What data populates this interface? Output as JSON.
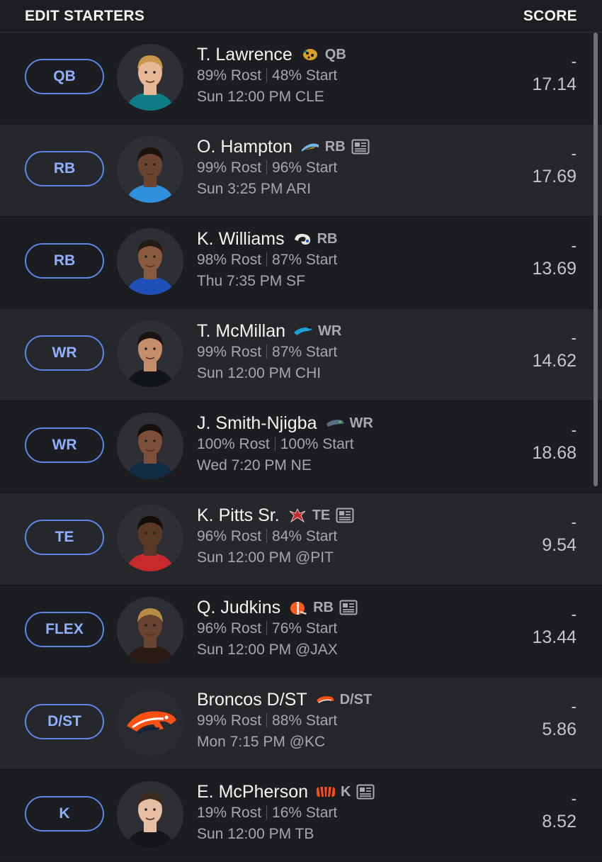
{
  "header": {
    "title": "EDIT STARTERS",
    "score_label": "SCORE"
  },
  "colors": {
    "slot_border": "#5d86e8",
    "slot_text": "#8fb0ff"
  },
  "rows": [
    {
      "slot": "QB",
      "name": "T. Lawrence",
      "team_logo": "jaguars-logo-icon",
      "pos": "QB",
      "news": false,
      "rost": "89% Rost",
      "start": "48% Start",
      "game": "Sun 12:00 PM CLE",
      "score_dash": "-",
      "score": "17.14",
      "avatar": {
        "skin": "#e8b896",
        "hair": "#c8964a",
        "jersey": "#0f7d86"
      }
    },
    {
      "slot": "RB",
      "name": "O. Hampton",
      "team_logo": "chargers-logo-icon",
      "pos": "RB",
      "news": true,
      "rost": "99% Rost",
      "start": "96% Start",
      "game": "Sun 3:25 PM ARI",
      "score_dash": "-",
      "score": "17.69",
      "avatar": {
        "skin": "#6b4430",
        "hair": "#1d120c",
        "jersey": "#2f8fdc"
      }
    },
    {
      "slot": "RB",
      "name": "K. Williams",
      "team_logo": "rams-logo-icon",
      "pos": "RB",
      "news": false,
      "rost": "98% Rost",
      "start": "87% Start",
      "game": "Thu 7:35 PM SF",
      "score_dash": "-",
      "score": "13.69",
      "avatar": {
        "skin": "#8a5a3e",
        "hair": "#241a14",
        "jersey": "#1f4fb8"
      }
    },
    {
      "slot": "WR",
      "name": "T. McMillan",
      "team_logo": "panthers-logo-icon",
      "pos": "WR",
      "news": false,
      "rost": "99% Rost",
      "start": "87% Start",
      "game": "Sun 12:00 PM CHI",
      "score_dash": "-",
      "score": "14.62",
      "avatar": {
        "skin": "#c48e6b",
        "hair": "#1b1410",
        "jersey": "#111418"
      }
    },
    {
      "slot": "WR",
      "name": "J. Smith-Njigba",
      "team_logo": "seahawks-logo-icon",
      "pos": "WR",
      "news": false,
      "rost": "100% Rost",
      "start": "100% Start",
      "game": "Wed 7:20 PM NE",
      "score_dash": "-",
      "score": "18.68",
      "avatar": {
        "skin": "#7c5038",
        "hair": "#15100c",
        "jersey": "#102c44"
      }
    },
    {
      "slot": "TE",
      "name": "K. Pitts Sr.",
      "team_logo": "falcons-logo-icon",
      "pos": "TE",
      "news": true,
      "rost": "96% Rost",
      "start": "84% Start",
      "game": "Sun 12:00 PM @PIT",
      "score_dash": "-",
      "score": "9.54",
      "avatar": {
        "skin": "#5a3826",
        "hair": "#130d09",
        "jersey": "#c8292c"
      }
    },
    {
      "slot": "FLEX",
      "name": "Q. Judkins",
      "team_logo": "browns-logo-icon",
      "pos": "RB",
      "news": true,
      "rost": "96% Rost",
      "start": "76% Start",
      "game": "Sun 12:00 PM @JAX",
      "score_dash": "-",
      "score": "13.44",
      "avatar": {
        "skin": "#6a4330",
        "hair": "#b98c4a",
        "jersey": "#2a1c14"
      }
    },
    {
      "slot": "D/ST",
      "name": "Broncos D/ST",
      "team_logo": "broncos-logo-icon",
      "pos": "D/ST",
      "news": false,
      "rost": "99% Rost",
      "start": "88% Start",
      "game": "Mon 7:15 PM @KC",
      "score_dash": "-",
      "score": "5.86",
      "avatar": {
        "type": "logo"
      }
    },
    {
      "slot": "K",
      "name": "E. McPherson",
      "team_logo": "bengals-logo-icon",
      "pos": "K",
      "news": true,
      "rost": "19% Rost",
      "start": "16% Start",
      "game": "Sun 12:00 PM TB",
      "score_dash": "-",
      "score": "8.52",
      "avatar": {
        "skin": "#e7bfa2",
        "hair": "#3a2a20",
        "jersey": "#15161a"
      }
    }
  ]
}
